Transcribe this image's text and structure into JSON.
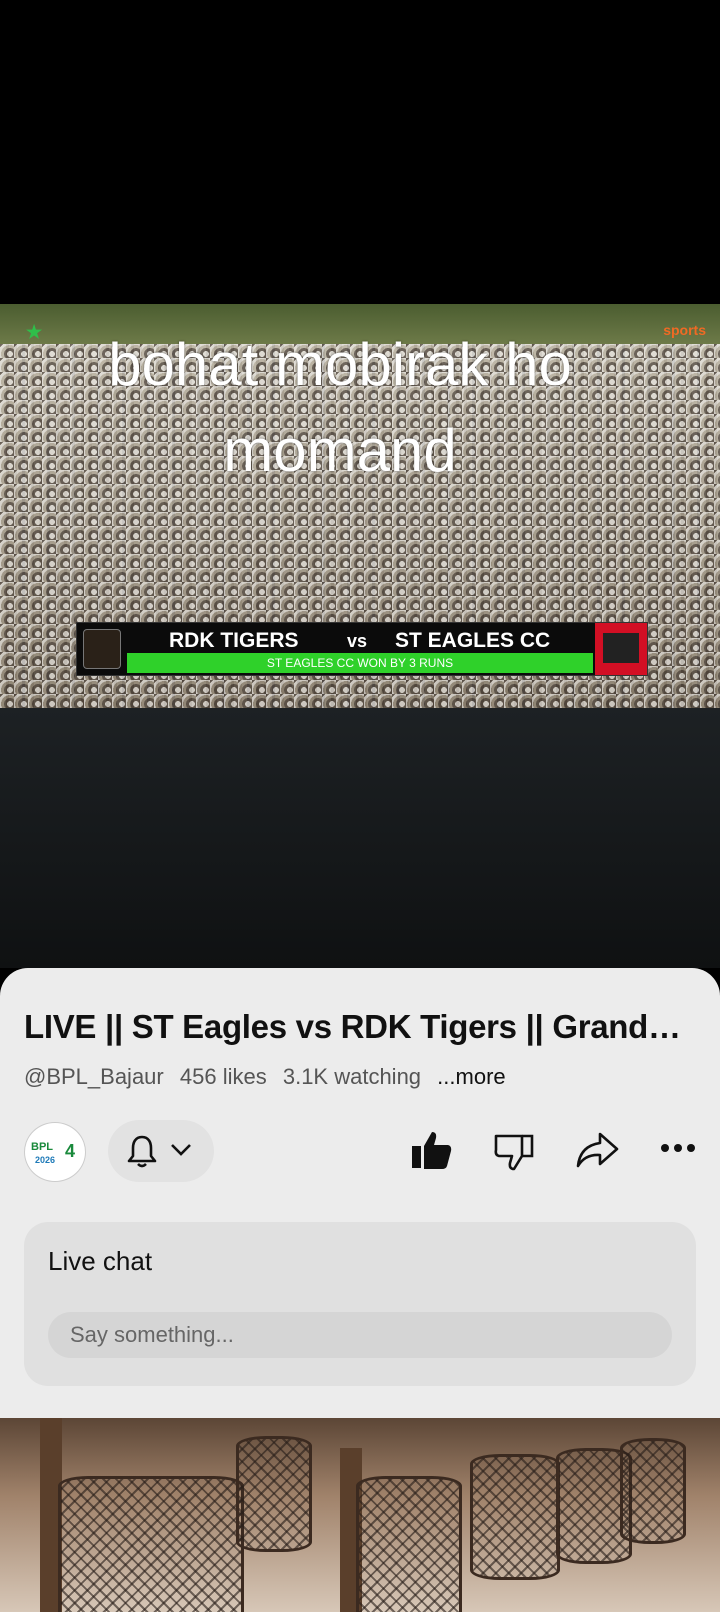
{
  "video": {
    "watermark_left": "★",
    "watermark_right": "sports",
    "caption_line1": "bohat mobirak ho",
    "caption_line2": "momand",
    "score": {
      "team1": "RDK TIGERS",
      "vs": "vs",
      "team2": "ST EAGLES CC",
      "result": "ST EAGLES CC WON BY 3 RUNS"
    }
  },
  "info": {
    "title": "LIVE || ST Eagles  vs RDK Tigers || Grand…",
    "channel": "@BPL_Bajaur",
    "likes": "456 likes",
    "watching": "3.1K watching",
    "more": "...more"
  },
  "channel_avatar": {
    "text": "BPL",
    "year": "2026",
    "number": "4"
  },
  "live_chat": {
    "title": "Live chat",
    "placeholder": "Say something..."
  },
  "icons": [
    "bell-icon",
    "chevron-down-icon",
    "thumbs-up-icon",
    "thumbs-down-icon",
    "share-icon",
    "more-options-icon"
  ]
}
